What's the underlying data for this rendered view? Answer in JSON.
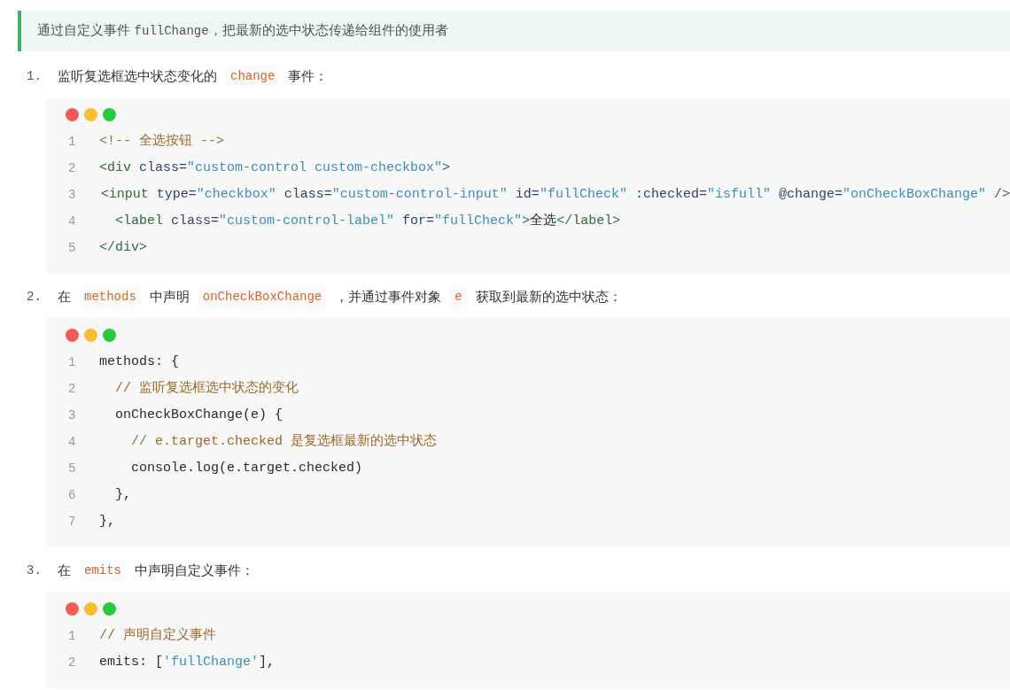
{
  "callout": [
    {
      "kind": "text",
      "text": "通过自定义事件 "
    },
    {
      "kind": "code",
      "text": "fullChange"
    },
    {
      "kind": "text",
      "text": "，把最新的选中状态传递给组件的使用者"
    }
  ],
  "steps": [
    {
      "number": "1.",
      "parts": [
        {
          "kind": "text",
          "text": "监听复选框选中状态变化的"
        },
        {
          "kind": "code",
          "text": "change"
        },
        {
          "kind": "text",
          "text": "事件："
        }
      ],
      "code": [
        {
          "number": "1",
          "tokens": [
            {
              "kind": "comment",
              "text": "<!-- 全选按钮 -->"
            }
          ]
        },
        {
          "number": "2",
          "tokens": [
            {
              "kind": "tag",
              "text": "<div"
            },
            {
              "kind": "attr",
              "text": " class="
            },
            {
              "kind": "string",
              "text": "\"custom-control custom-checkbox\""
            },
            {
              "kind": "tag",
              "text": ">"
            }
          ]
        },
        {
          "number": "3",
          "tokens": [
            {
              "kind": "tag",
              "text": "  <input"
            },
            {
              "kind": "attr",
              "text": " type="
            },
            {
              "kind": "string",
              "text": "\"checkbox\""
            },
            {
              "kind": "attr",
              "text": " class="
            },
            {
              "kind": "string",
              "text": "\"custom-control-input\""
            },
            {
              "kind": "attr",
              "text": " id="
            },
            {
              "kind": "string",
              "text": "\"fullCheck\""
            },
            {
              "kind": "attr",
              "text": " :checked="
            },
            {
              "kind": "string",
              "text": "\"isfull\""
            },
            {
              "kind": "attr",
              "text": " @change="
            },
            {
              "kind": "string",
              "text": "\"onCheckBoxChange\""
            },
            {
              "kind": "tag",
              "text": " />"
            }
          ]
        },
        {
          "number": "4",
          "tokens": [
            {
              "kind": "tag",
              "text": "  <label"
            },
            {
              "kind": "attr",
              "text": " class="
            },
            {
              "kind": "string",
              "text": "\"custom-control-label\""
            },
            {
              "kind": "attr",
              "text": " for="
            },
            {
              "kind": "string",
              "text": "\"fullCheck\""
            },
            {
              "kind": "tag",
              "text": ">"
            },
            {
              "kind": "plain",
              "text": "全选"
            },
            {
              "kind": "tag",
              "text": "</label>"
            }
          ]
        },
        {
          "number": "5",
          "tokens": [
            {
              "kind": "tag",
              "text": "</div>"
            }
          ]
        }
      ]
    },
    {
      "number": "2.",
      "parts": [
        {
          "kind": "text",
          "text": "在"
        },
        {
          "kind": "code",
          "text": "methods"
        },
        {
          "kind": "text",
          "text": "中声明"
        },
        {
          "kind": "code",
          "text": "onCheckBoxChange"
        },
        {
          "kind": "text",
          "text": "，并通过事件对象"
        },
        {
          "kind": "code",
          "text": "e"
        },
        {
          "kind": "text",
          "text": "获取到最新的选中状态："
        }
      ],
      "code": [
        {
          "number": "1",
          "tokens": [
            {
              "kind": "plain",
              "text": "methods: {"
            }
          ]
        },
        {
          "number": "2",
          "tokens": [
            {
              "kind": "comment",
              "text": "  // 监听复选框选中状态的变化"
            }
          ]
        },
        {
          "number": "3",
          "tokens": [
            {
              "kind": "plain",
              "text": "  onCheckBoxChange(e) {"
            }
          ]
        },
        {
          "number": "4",
          "tokens": [
            {
              "kind": "comment",
              "text": "    // e.target.checked 是复选框最新的选中状态"
            }
          ]
        },
        {
          "number": "5",
          "tokens": [
            {
              "kind": "plain",
              "text": "    console.log(e.target.checked)"
            }
          ]
        },
        {
          "number": "6",
          "tokens": [
            {
              "kind": "plain",
              "text": "  },"
            }
          ]
        },
        {
          "number": "7",
          "tokens": [
            {
              "kind": "plain",
              "text": "},"
            }
          ]
        }
      ]
    },
    {
      "number": "3.",
      "parts": [
        {
          "kind": "text",
          "text": "在"
        },
        {
          "kind": "code",
          "text": "emits"
        },
        {
          "kind": "text",
          "text": "中声明自定义事件："
        }
      ],
      "code": [
        {
          "number": "1",
          "tokens": [
            {
              "kind": "comment",
              "text": "// 声明自定义事件"
            }
          ]
        },
        {
          "number": "2",
          "tokens": [
            {
              "kind": "plain",
              "text": "emits: ["
            },
            {
              "kind": "string",
              "text": "'fullChange'"
            },
            {
              "kind": "plain",
              "text": "],"
            }
          ]
        }
      ]
    }
  ]
}
